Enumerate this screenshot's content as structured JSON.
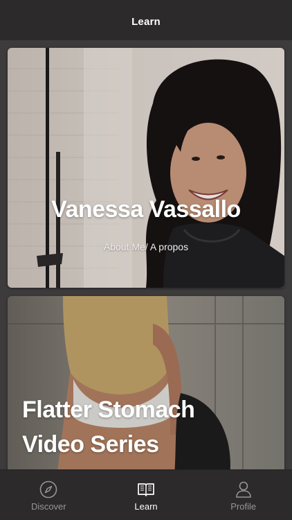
{
  "nav": {
    "title": "Learn"
  },
  "cards": [
    {
      "title": "Vanessa Vassallo",
      "subtitle": "About Me/ A propos"
    },
    {
      "title_lines": [
        "Flatter Stomach",
        "Video Series"
      ],
      "subtitle": ""
    }
  ],
  "tabs": [
    {
      "label": "Discover",
      "icon": "compass-icon",
      "active": false
    },
    {
      "label": "Learn",
      "icon": "book-icon",
      "active": true
    },
    {
      "label": "Profile",
      "icon": "person-icon",
      "active": false
    }
  ],
  "colors": {
    "background": "#3d3b3b",
    "bar": "#2c2a2a",
    "active_tab": "#ffffff",
    "inactive_tab": "#9a9696"
  }
}
